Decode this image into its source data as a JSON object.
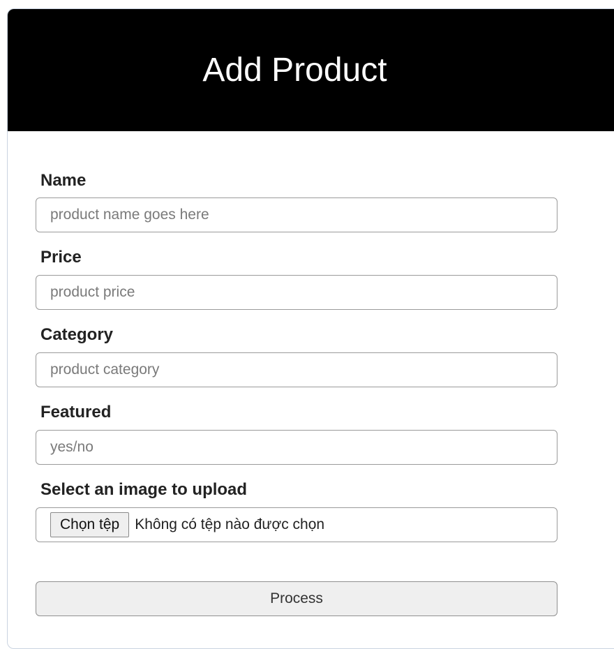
{
  "header": {
    "title": "Add Product"
  },
  "form": {
    "name": {
      "label": "Name",
      "placeholder": "product name goes here",
      "value": ""
    },
    "price": {
      "label": "Price",
      "placeholder": "product price",
      "value": ""
    },
    "category": {
      "label": "Category",
      "placeholder": "product category",
      "value": ""
    },
    "featured": {
      "label": "Featured",
      "placeholder": "yes/no",
      "value": ""
    },
    "image": {
      "label": "Select an image to upload",
      "button_label": "Chọn tệp",
      "status": "Không có tệp nào được chọn"
    },
    "submit_label": "Process"
  },
  "colors": {
    "header_background": "#000000",
    "header_text": "#ffffff",
    "button_background": "#efefef"
  }
}
